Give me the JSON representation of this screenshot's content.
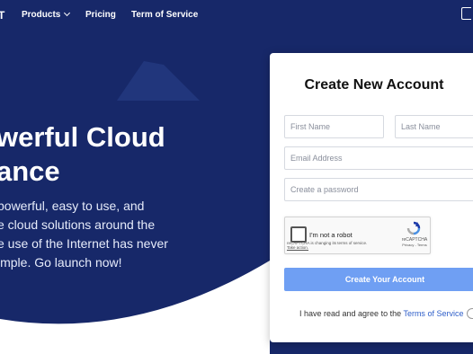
{
  "nav": {
    "logo": "T",
    "items": [
      {
        "label": "Products"
      },
      {
        "label": "Pricing"
      },
      {
        "label": "Term of Service"
      }
    ]
  },
  "hero": {
    "headline": [
      "werful Cloud",
      "ance"
    ],
    "subtext": [
      "powerful, easy to use, and",
      "e cloud solutions around the",
      "e use of the Internet has never",
      "imple. Go launch now!"
    ]
  },
  "signup": {
    "title": "Create New Account",
    "first_name_placeholder": "First Name",
    "last_name_placeholder": "Last Name",
    "email_placeholder": "Email Address",
    "password_placeholder": "Create a password",
    "captcha_label": "I'm not a robot",
    "captcha_notice": "reCAPTCHA is changing its terms of service.",
    "captcha_action": "Take action.",
    "captcha_brand": "reCAPTCHA",
    "captcha_links": "Privacy - Terms",
    "submit_label": "Create Your Account",
    "agree_text": "I have read and agree to the ",
    "agree_link": "Terms of Service"
  },
  "colors": {
    "hero_background": "#172869",
    "button": "#6f9ff3",
    "link": "#2f5fc9"
  }
}
